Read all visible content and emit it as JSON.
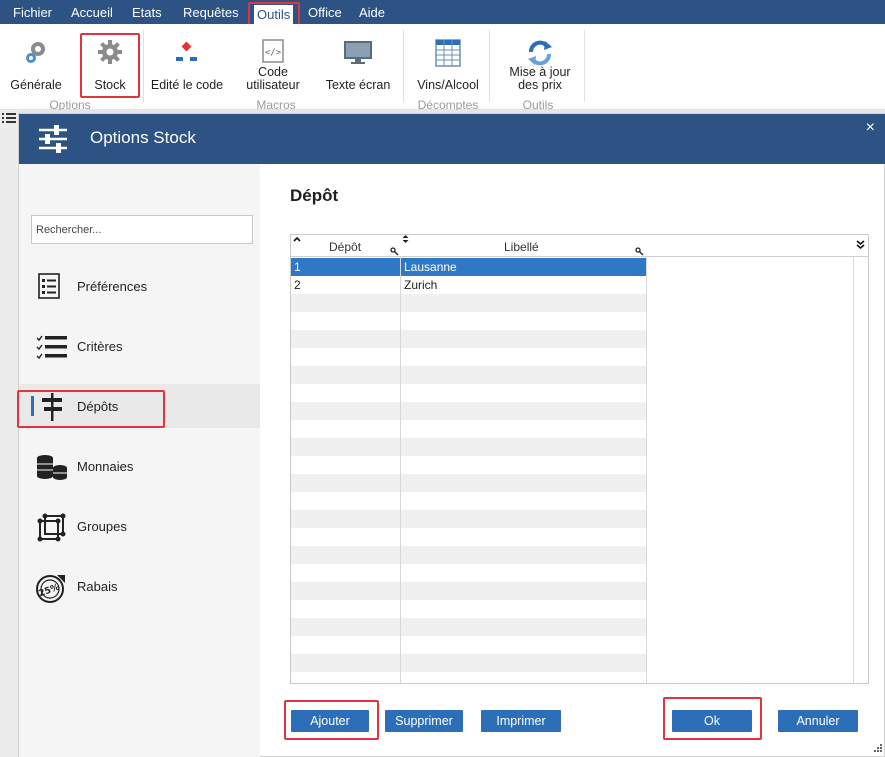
{
  "menu": {
    "items": [
      "Fichier",
      "Accueil",
      "Etats",
      "Requêtes",
      "Outils",
      "Office",
      "Aide"
    ],
    "active": "Outils"
  },
  "ribbon": {
    "buttons": {
      "generale": "Générale",
      "stock": "Stock",
      "edite": "Edité le code",
      "code_l1": "Code",
      "code_l2": "utilisateur",
      "texte": "Texte écran",
      "vins": "Vins/Alcool",
      "maj_l1": "Mise à jour",
      "maj_l2": "des prix"
    },
    "groups": {
      "options": "Options",
      "macros": "Macros",
      "decomptes": "Décomptes",
      "outils": "Outils"
    }
  },
  "dialog": {
    "title": "Options Stock",
    "close": "×",
    "search": {
      "placeholder": "Rechercher..."
    },
    "sidebar": [
      {
        "label": "Préférences",
        "icon": "preferences-list-icon"
      },
      {
        "label": "Critères",
        "icon": "criteria-checklist-icon"
      },
      {
        "label": "Dépôts",
        "icon": "depots-signpost-icon",
        "active": true
      },
      {
        "label": "Monnaies",
        "icon": "coins-stack-icon"
      },
      {
        "label": "Groupes",
        "icon": "groups-cube-icon"
      },
      {
        "label": "Rabais",
        "icon": "discount-badge-icon"
      }
    ],
    "content_title": "Dépôt",
    "grid": {
      "columns": [
        "Dépôt",
        "Libellé"
      ],
      "rows": [
        {
          "depot": "1",
          "libelle": "Lausanne",
          "selected": true
        },
        {
          "depot": "2",
          "libelle": "Zurich",
          "selected": false
        }
      ]
    },
    "buttons": {
      "ajouter": "Ajouter",
      "supprimer": "Supprimer",
      "imprimer": "Imprimer",
      "ok": "Ok",
      "annuler": "Annuler"
    }
  },
  "colors": {
    "header_blue": "#2c5383",
    "button_blue": "#2c6fb8",
    "selection_blue": "#2f78c6",
    "highlight_red": "#e0343f"
  }
}
